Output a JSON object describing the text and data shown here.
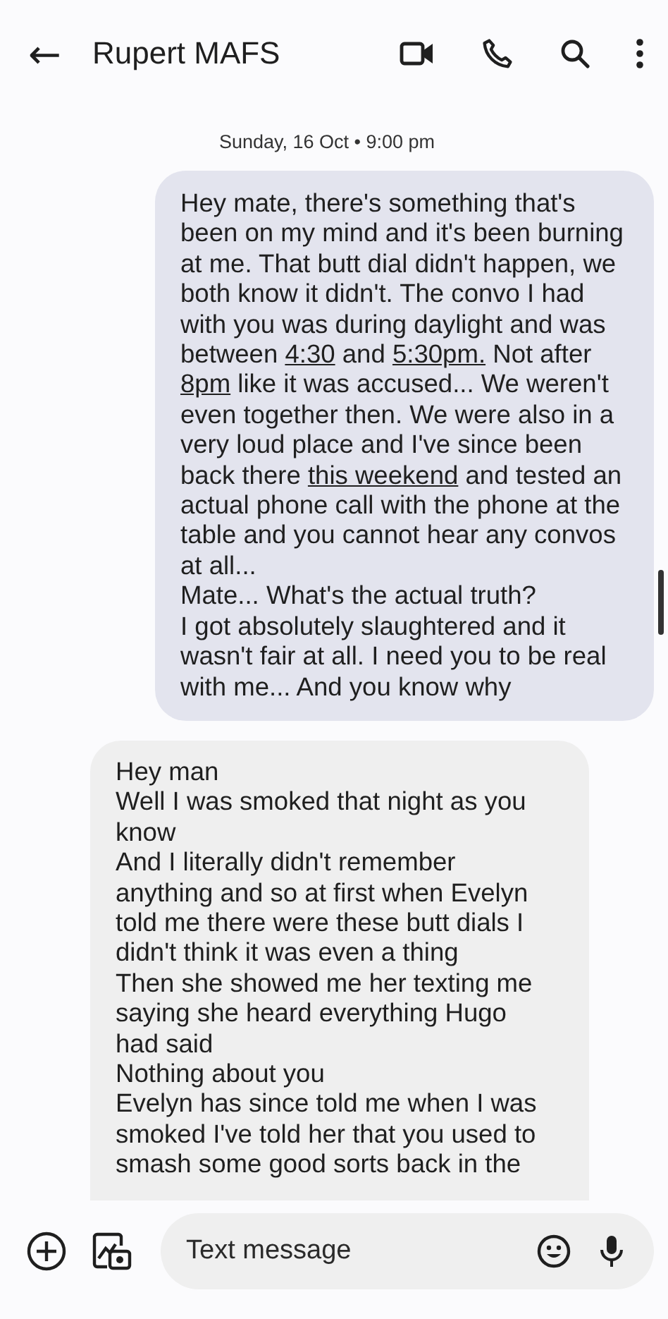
{
  "header": {
    "back": "←",
    "title": "Rupert MAFS"
  },
  "date_separator": "Sunday, 16 Oct • 9:00 pm",
  "messages": [
    {
      "kind": "outgoing",
      "segments": [
        {
          "text": "Hey mate, there's something that's been on my mind and it's been burning at me. That butt dial didn't happen, we both know it didn't. The convo I had with you was during daylight and was between ",
          "link": false
        },
        {
          "text": "4:30",
          "link": true
        },
        {
          "text": " and ",
          "link": false
        },
        {
          "text": "5:30pm.",
          "link": true
        },
        {
          "text": " Not after ",
          "link": false
        },
        {
          "text": "8pm",
          "link": true
        },
        {
          "text": " like it was accused... We weren't even together then. We were also in a very loud place and I've since been back there ",
          "link": false
        },
        {
          "text": "this weekend",
          "link": true
        },
        {
          "text": " and tested an actual phone call with the phone at the table and you cannot hear any convos at all...\nMate... What's the actual truth?\nI got absolutely slaughtered and it wasn't fair at all. I need you to be real with me... And you know why",
          "link": false
        }
      ]
    },
    {
      "kind": "incoming",
      "segments": [
        {
          "text": "Hey man\nWell I was smoked that night as you know\nAnd I literally didn't remember anything and so at first when Evelyn told me there were these butt dials I didn't think it was even a thing\nThen she showed me her texting me saying she heard everything Hugo had said\nNothing about you\nEvelyn has since told me when I was smoked I've told her that you used to smash some good sorts back in the",
          "link": false
        }
      ]
    }
  ],
  "compose": {
    "placeholder": "Text message"
  }
}
